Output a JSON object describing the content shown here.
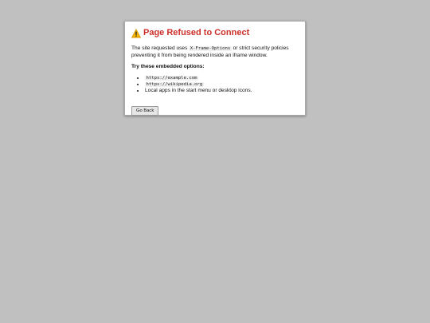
{
  "dialog": {
    "icon": "warning-triangle-icon",
    "title": "Page Refused to Connect",
    "desc_pre": "The site requested uses ",
    "desc_code": "X-Frame-Options",
    "desc_post": " or strict security policies preventing it from being rendered inside an iframe window.",
    "options_heading": "Try these embedded options:",
    "options": [
      {
        "code": "https://example.com"
      },
      {
        "code": "https://wikipedia.org"
      },
      {
        "text": "Local apps in the start menu or desktop icons."
      }
    ],
    "go_back_label": "Go Back"
  },
  "colors": {
    "background": "#c0c0c0",
    "title": "#cc2f2a",
    "warning": "#f5b400"
  }
}
